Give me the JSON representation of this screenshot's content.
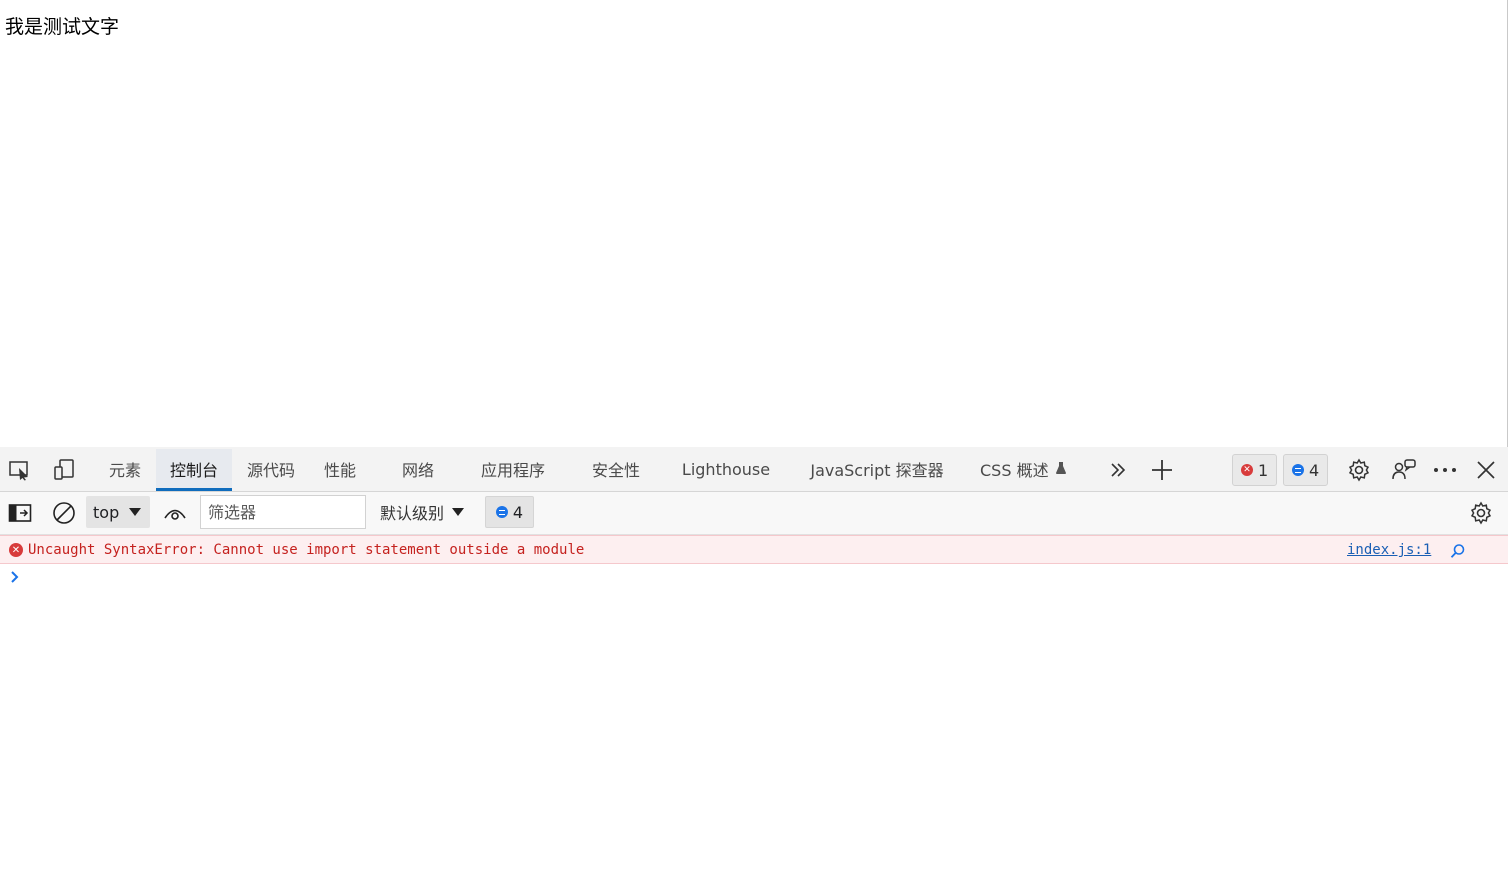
{
  "page": {
    "text": "我是测试文字"
  },
  "devtools": {
    "tabs": [
      {
        "label": "元素",
        "active": false
      },
      {
        "label": "控制台",
        "active": true
      },
      {
        "label": "源代码",
        "active": false
      },
      {
        "label": "性能",
        "active": false
      },
      {
        "label": "网络",
        "active": false
      },
      {
        "label": "应用程序",
        "active": false
      },
      {
        "label": "安全性",
        "active": false
      },
      {
        "label": "Lighthouse",
        "active": false
      },
      {
        "label": "JavaScript 探查器",
        "active": false
      },
      {
        "label": "CSS 概述",
        "active": false
      }
    ],
    "error_count": "1",
    "info_count": "4"
  },
  "console": {
    "context": "top",
    "filter_placeholder": "筛选器",
    "level": "默认级别",
    "issues_count": "4",
    "messages": [
      {
        "type": "error",
        "text": "Uncaught SyntaxError: Cannot use import statement outside a module",
        "source": "index.js:1"
      }
    ]
  },
  "colors": {
    "accent": "#0f6cbd",
    "error": "#c5221f",
    "error_bg": "#fdeff0",
    "info": "#1a73e8"
  }
}
